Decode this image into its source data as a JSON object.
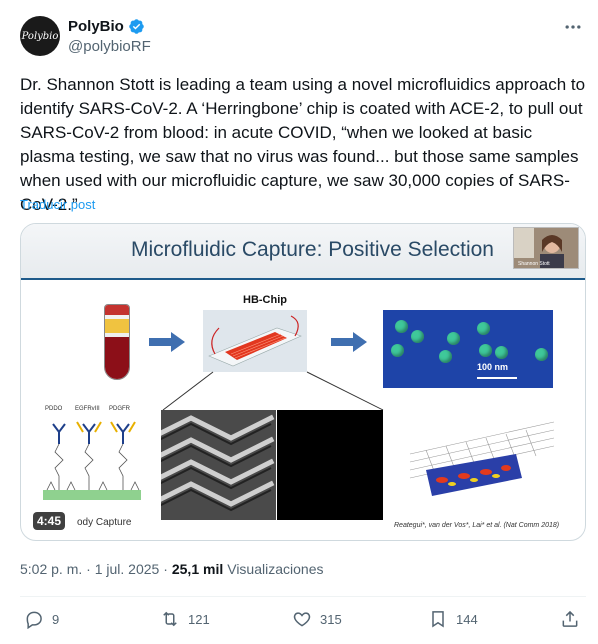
{
  "author": {
    "name": "PolyBio",
    "handle": "@polybioRF",
    "avatar_text": "Polybio"
  },
  "tweet": {
    "text": "Dr. Shannon Stott is leading a team using a novel microfluidics approach to identify SARS-CoV-2. A ‘Herringbone’ chip is coated with ACE-2, to pull out SARS-CoV-2 from blood: in acute COVID, “when we looked at basic plasma testing, we saw that no virus was found... but those same samples when used with our microfluidic capture, we saw 30,000 copies of SARS-CoV-2.”",
    "translate_label": "Traducir post"
  },
  "media": {
    "slide_title": "Microfluidic Capture: Positive Selection",
    "hb_chip_label": "HB-Chip",
    "scale_label": "100 nm",
    "antibody_labels": [
      "PDDO",
      "EGFRvIII",
      "PDGFR"
    ],
    "antibody_caption": "ody Capture",
    "citation": "Reategui*, van der Vos*, Lai* et al. (Nat Comm 2018)",
    "duration": "4:45",
    "webcam_caption": "Shannon Stott"
  },
  "meta": {
    "timestamp": "5:02 p. m. · 1 jul. 2025 ·",
    "views_count": "25,1 mil",
    "views_label": "Visualizaciones"
  },
  "actions": {
    "replies": "9",
    "reposts": "121",
    "likes": "315",
    "bookmarks": "144"
  },
  "colors": {
    "link": "#1d9bf0",
    "secondary": "#536471",
    "verified": "#1d9bf0",
    "slide_accent": "#1e5a8a"
  }
}
